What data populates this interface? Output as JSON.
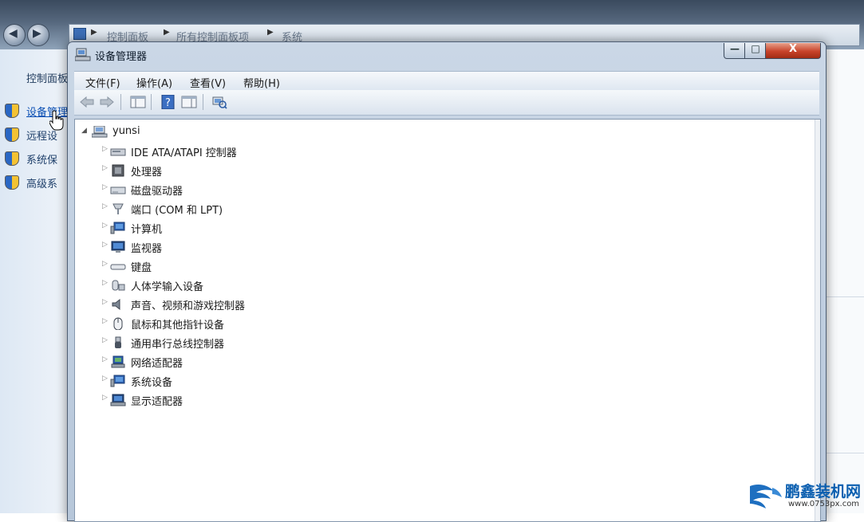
{
  "background_window": {
    "breadcrumbs": [
      "控制面板",
      "所有控制面板项",
      "系统"
    ],
    "sidebar_title": "控制面板",
    "sidebar_items": [
      {
        "label": "设备管理",
        "icon": "shield-icon"
      },
      {
        "label": "远程设",
        "icon": "shield-icon"
      },
      {
        "label": "系统保",
        "icon": "shield-icon"
      },
      {
        "label": "高级系",
        "icon": "shield-icon"
      }
    ]
  },
  "window": {
    "title": "设备管理器",
    "controls": {
      "minimize": "—",
      "maximize": "□",
      "close": "X"
    }
  },
  "menubar": [
    "文件(F)",
    "操作(A)",
    "查看(V)",
    "帮助(H)"
  ],
  "toolbar": [
    "back-icon",
    "forward-icon",
    "show-hide-console-tree-icon",
    "help-icon",
    "properties-pane-icon",
    "scan-hardware-icon"
  ],
  "tree": {
    "root": {
      "label": "yunsi",
      "icon": "computer-icon"
    },
    "categories": [
      {
        "label": "IDE ATA/ATAPI 控制器",
        "icon": "ide-controller-icon"
      },
      {
        "label": "处理器",
        "icon": "processor-icon"
      },
      {
        "label": "磁盘驱动器",
        "icon": "disk-drive-icon"
      },
      {
        "label": "端口 (COM 和 LPT)",
        "icon": "port-icon"
      },
      {
        "label": "计算机",
        "icon": "computer-icon"
      },
      {
        "label": "监视器",
        "icon": "monitor-icon"
      },
      {
        "label": "键盘",
        "icon": "keyboard-icon"
      },
      {
        "label": "人体学输入设备",
        "icon": "hid-icon"
      },
      {
        "label": "声音、视频和游戏控制器",
        "icon": "speaker-icon"
      },
      {
        "label": "鼠标和其他指针设备",
        "icon": "mouse-icon"
      },
      {
        "label": "通用串行总线控制器",
        "icon": "usb-icon"
      },
      {
        "label": "网络适配器",
        "icon": "network-adapter-icon"
      },
      {
        "label": "系统设备",
        "icon": "system-device-icon"
      },
      {
        "label": "显示适配器",
        "icon": "display-adapter-icon"
      }
    ]
  },
  "watermark": {
    "brand": "鹏鑫装机网",
    "url": "www.0753px.com"
  }
}
